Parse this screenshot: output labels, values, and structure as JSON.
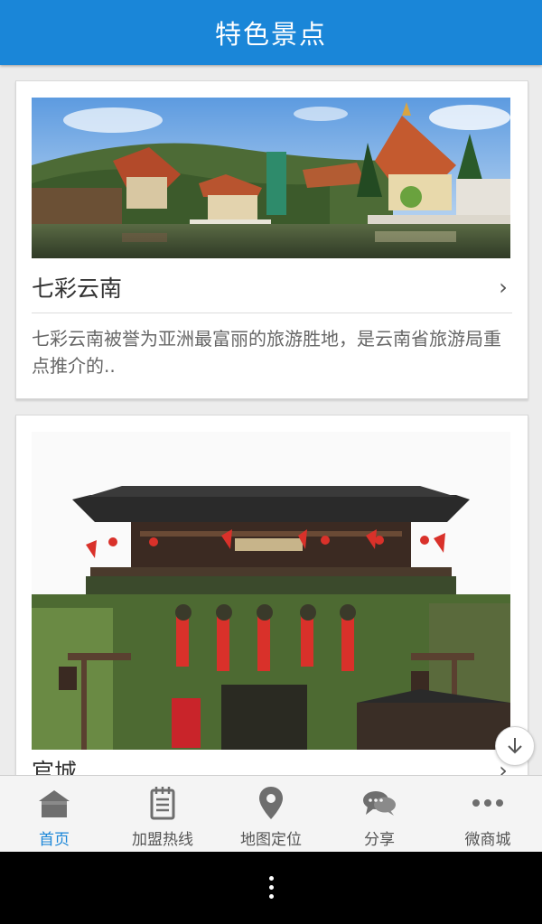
{
  "app_bar": {
    "title": "特色景点"
  },
  "cards": [
    {
      "title": "七彩云南",
      "description": "七彩云南被誉为亚洲最富丽的旅游胜地，是云南省旅游局重点推介的..",
      "chevron": "›"
    },
    {
      "title": "官城",
      "chevron": "›"
    }
  ],
  "tabs": [
    {
      "label": "首页",
      "icon": "home-icon",
      "active": true
    },
    {
      "label": "加盟热线",
      "icon": "notepad-icon",
      "active": false
    },
    {
      "label": "地图定位",
      "icon": "map-pin-icon",
      "active": false
    },
    {
      "label": "分享",
      "icon": "chat-bubbles-icon",
      "active": false
    },
    {
      "label": "微商城",
      "icon": "more-dots-icon",
      "active": false
    }
  ],
  "colors": {
    "accent": "#1a86d8",
    "tab_icon": "#6e6e6e"
  }
}
